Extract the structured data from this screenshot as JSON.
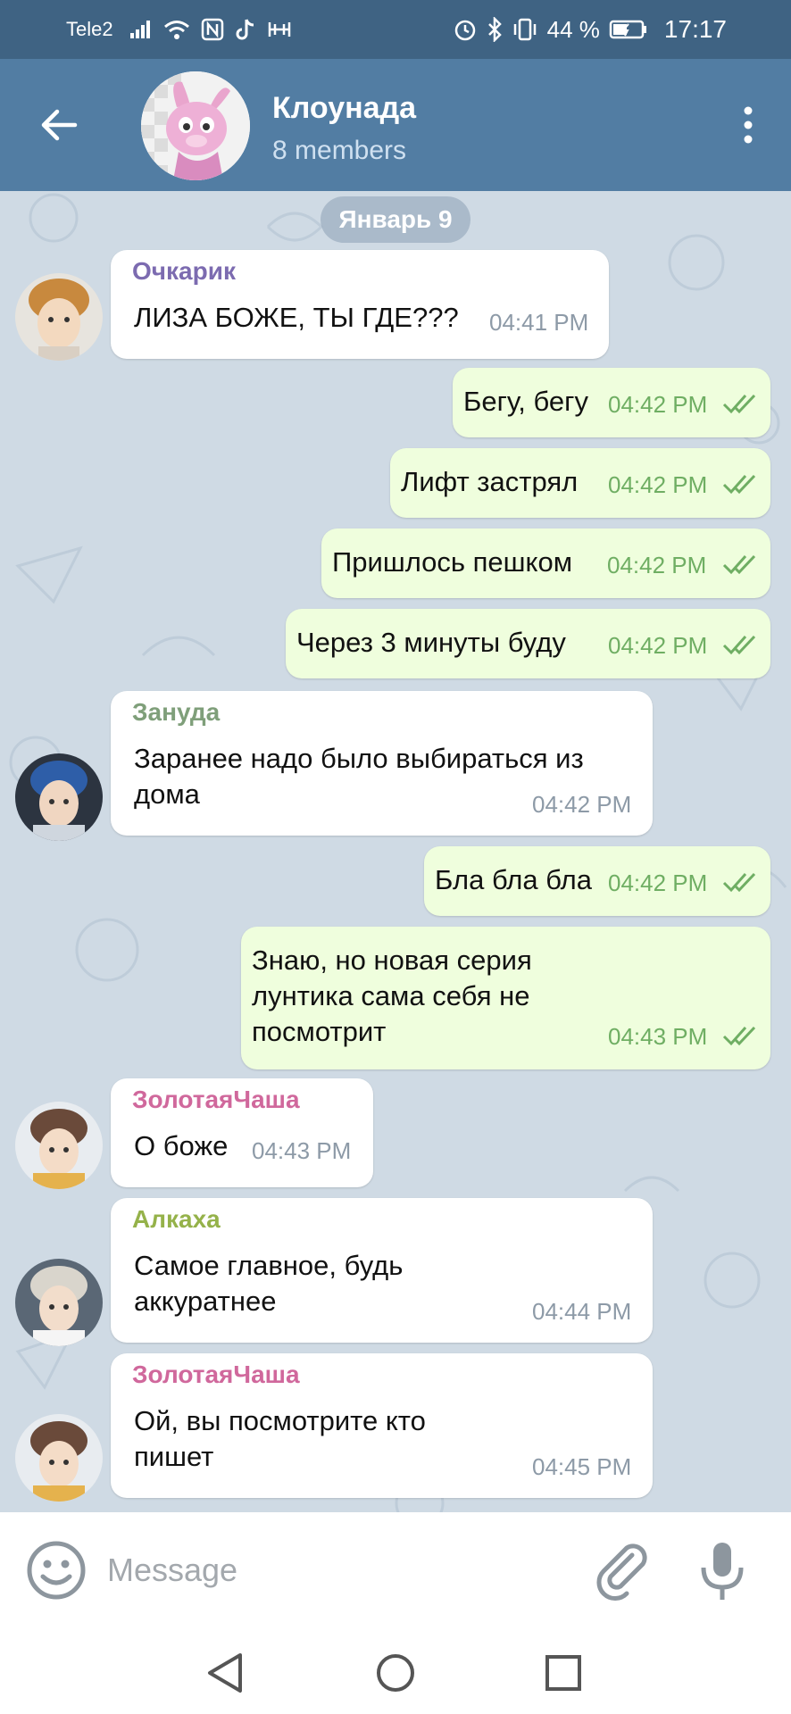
{
  "status_bar": {
    "carrier": "Tele2",
    "battery": "44 %",
    "time": "17:17"
  },
  "header": {
    "title": "Клоунада",
    "members": "8 members",
    "back_icon": "arrow-left-icon",
    "menu_icon": "more-vertical-icon"
  },
  "chat": {
    "date": "Январь 9",
    "messages": [
      {
        "dir": "in",
        "sender": "Очкарик",
        "sender_color": "#7c6bb0",
        "text": "ЛИЗА БОЖЕ, ТЫ ГДЕ???",
        "time": "04:41 PM"
      },
      {
        "dir": "out",
        "text": "Бегу, бегу",
        "time": "04:42 PM"
      },
      {
        "dir": "out",
        "text": "Лифт застрял",
        "time": "04:42 PM"
      },
      {
        "dir": "out",
        "text": "Пришлось пешком",
        "time": "04:42 PM"
      },
      {
        "dir": "out",
        "text": "Через 3 минуты буду",
        "time": "04:42 PM"
      },
      {
        "dir": "in",
        "sender": "Зануда",
        "sender_color": "#7f9f7a",
        "text1": "Заранее надо было выбираться из",
        "text2": "дома",
        "time": "04:42 PM"
      },
      {
        "dir": "out",
        "text": "Бла бла бла",
        "time": "04:42 PM"
      },
      {
        "dir": "out",
        "text1": "Знаю, но новая серия",
        "text2": "лунтика сама себя не",
        "text3": "посмотрит",
        "time": "04:43 PM"
      },
      {
        "dir": "in",
        "sender": "ЗолотаяЧаша",
        "sender_color": "#d0689c",
        "text": "О боже",
        "time": "04:43 PM"
      },
      {
        "dir": "in",
        "sender": "Алкаха",
        "sender_color": "#95b24a",
        "text1": "Самое главное, будь",
        "text2": "аккуратнее",
        "time": "04:44 PM"
      },
      {
        "dir": "in",
        "sender": "ЗолотаяЧаша",
        "sender_color": "#d0689c",
        "text1": "Ой, вы посмотрите кто",
        "text2": "пишет",
        "time": "04:45 PM"
      }
    ]
  },
  "input": {
    "placeholder": "Message",
    "emoji_icon": "smile-icon",
    "attach_icon": "paperclip-icon",
    "mic_icon": "microphone-icon"
  },
  "nav": {
    "back_icon": "nav-back-triangle-icon",
    "home_icon": "nav-home-circle-icon",
    "recents_icon": "nav-recents-square-icon"
  },
  "colors": {
    "status_bar": "#3f6383",
    "header": "#527da3",
    "chat_bg": "#cfdae4",
    "incoming_bubble": "#ffffff",
    "outgoing_bubble": "#effedd",
    "outgoing_time": "#6fae63"
  }
}
